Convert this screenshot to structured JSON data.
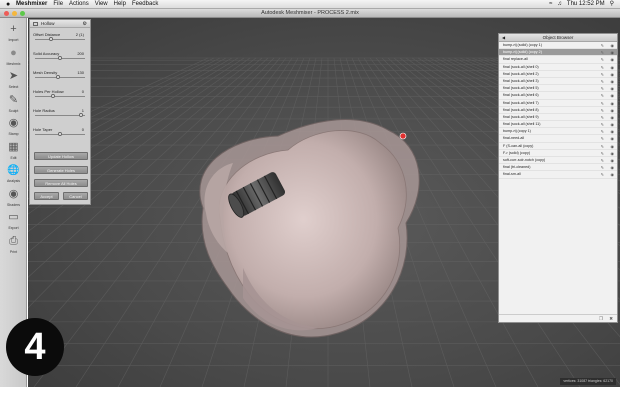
{
  "menubar": {
    "apple": "",
    "items": [
      "Meshmixer",
      "File",
      "Actions",
      "View",
      "Help",
      "Feedback"
    ],
    "clock": "Thu 12:52 PM"
  },
  "window": {
    "title": "Autodesk Meshmixer - PROCESS 2.mix"
  },
  "toolbar": {
    "items": [
      {
        "label": "Import",
        "icon": "plus-icon"
      },
      {
        "label": "Meshmix",
        "icon": "sphere-icon"
      },
      {
        "label": "Select",
        "icon": "arrow-icon"
      },
      {
        "label": "Sculpt",
        "icon": "brush-icon"
      },
      {
        "label": "Stamp",
        "icon": "stamp-icon"
      },
      {
        "label": "Edit",
        "icon": "cube-icon"
      },
      {
        "label": "Analysis",
        "icon": "globe-icon"
      },
      {
        "label": "Shaders",
        "icon": "shader-icon"
      },
      {
        "label": "Export",
        "icon": "export-icon"
      },
      {
        "label": "Print",
        "icon": "printer-icon"
      }
    ]
  },
  "hollow_panel": {
    "title": "Hollow",
    "params": [
      {
        "name": "Offset Distance",
        "value": "2 (1)",
        "level": 0.3
      },
      {
        "name": "Solid Accuracy",
        "value": "200",
        "level": 0.5
      },
      {
        "name": "Mesh Density",
        "value": "130",
        "level": 0.45
      },
      {
        "name": "Holes Per Hollow",
        "value": "0",
        "level": 0.35
      },
      {
        "name": "Hole Radius",
        "value": "1",
        "level": 0.95
      },
      {
        "name": "Hole Taper",
        "value": "0",
        "level": 0.5
      }
    ],
    "buttons": {
      "update": "Update Hollow",
      "generate": "Generate Holes",
      "remove": "Remove All Holes",
      "accept": "Accept",
      "cancel": "Cancel"
    }
  },
  "object_browser": {
    "title": "Object Browser",
    "rows": [
      {
        "label": "bump-rtj (solid) (copy 1)",
        "selected": false
      },
      {
        "label": "bump-rtj (solid) (copy 2)",
        "selected": true
      },
      {
        "label": "final replace-all",
        "selected": false
      },
      {
        "label": "final (sock-all (shell 0)",
        "selected": false
      },
      {
        "label": "final (sock-all (shell 2)",
        "selected": false
      },
      {
        "label": "final (sock-all (shell 3)",
        "selected": false
      },
      {
        "label": "final (sock-all (shell 5)",
        "selected": false
      },
      {
        "label": "final (sock-all (shell 6)",
        "selected": false
      },
      {
        "label": "final (sock-all (shell 7)",
        "selected": false
      },
      {
        "label": "final (sock-all (shell 8)",
        "selected": false
      },
      {
        "label": "final (sock-all (shell 9)",
        "selected": false
      },
      {
        "label": "final (sock-all (shell 11)",
        "selected": false
      },
      {
        "label": "bump-rtj (copy 1)",
        "selected": false
      },
      {
        "label": "final-need-all",
        "selected": false
      },
      {
        "label": "F (S-can-all (copy)",
        "selected": false
      },
      {
        "label": "F-r (solid) (copy)",
        "selected": false
      },
      {
        "label": "soft-curr-solr-notch (copy)",
        "selected": false
      },
      {
        "label": "final (tri-cleaned)",
        "selected": false
      },
      {
        "label": "final-sm-all",
        "selected": false
      }
    ]
  },
  "status": "vertices: 31087  triangles: 62170",
  "badge": "4",
  "colors": {
    "viewport": "#4a4a4a",
    "mesh": "#c9b4b2",
    "connector": "#3a3a3a",
    "marker": "#e03030"
  }
}
